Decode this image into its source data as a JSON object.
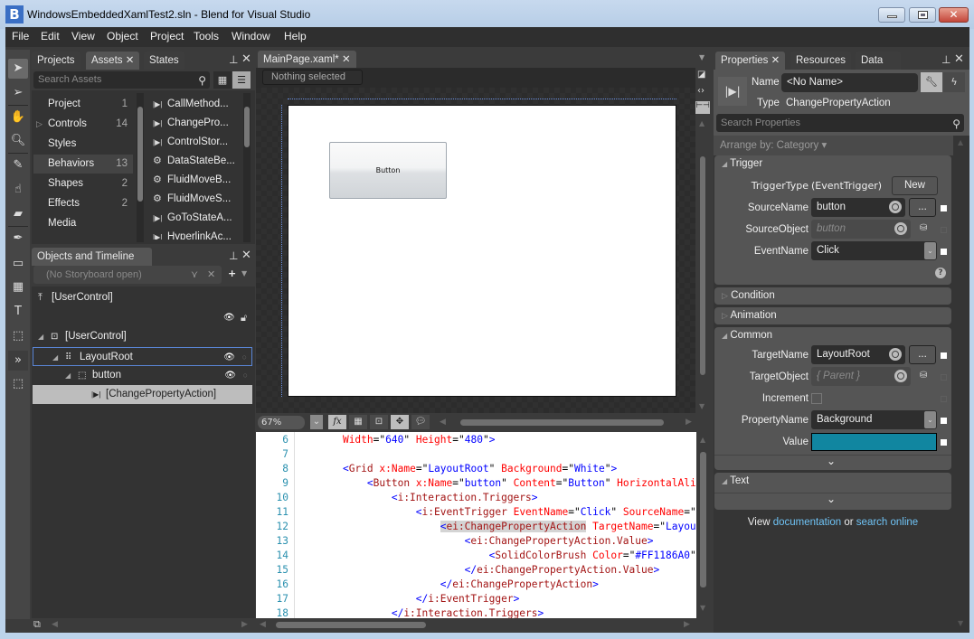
{
  "window": {
    "title": "WindowsEmbeddedXamlTest2.sln - Blend for Visual Studio",
    "logo": "B",
    "close_glyph": "✕"
  },
  "menu": [
    "File",
    "Edit",
    "View",
    "Object",
    "Project",
    "Tools",
    "Window",
    "Help"
  ],
  "tools": [
    "selection-tool",
    "direct-selection-tool",
    "pan-tool",
    "zoom-tool",
    "eyedropper-tool",
    "paint-bucket-tool",
    "gradient-tool",
    "pen-tool",
    "rectangle-tool",
    "grid-tool",
    "textblock-tool",
    "button-tool",
    "assets-tool",
    "recent-asset-tool"
  ],
  "assets_panel": {
    "tabs": [
      "Projects",
      "Assets",
      "States"
    ],
    "active_tab": "Assets",
    "search_placeholder": "Search Assets",
    "categories": [
      {
        "label": "Project",
        "count": "1"
      },
      {
        "label": "Controls",
        "count": "14",
        "expandable": true
      },
      {
        "label": "Styles",
        "count": ""
      },
      {
        "label": "Behaviors",
        "count": "13",
        "selected": true
      },
      {
        "label": "Shapes",
        "count": "2"
      },
      {
        "label": "Effects",
        "count": "2"
      },
      {
        "label": "Media",
        "count": ""
      }
    ],
    "items": [
      {
        "icon": "action-icon",
        "label": "CallMethod..."
      },
      {
        "icon": "action-icon",
        "label": "ChangePro..."
      },
      {
        "icon": "action-icon",
        "label": "ControlStor..."
      },
      {
        "icon": "behavior-icon",
        "label": "DataStateBe..."
      },
      {
        "icon": "behavior-icon",
        "label": "FluidMoveB..."
      },
      {
        "icon": "behavior-icon",
        "label": "FluidMoveS..."
      },
      {
        "icon": "action-icon",
        "label": "GoToStateA..."
      },
      {
        "icon": "action-icon",
        "label": "HyperlinkAc..."
      }
    ]
  },
  "objects_panel": {
    "title": "Objects and Timeline",
    "storyboard": "(No Storyboard open)",
    "scope": "[UserControl]",
    "tree": [
      {
        "label": "[UserControl]",
        "icon": "usercontrol-icon",
        "depth": 0
      },
      {
        "label": "LayoutRoot",
        "icon": "grid-icon",
        "depth": 1,
        "highlighted": true
      },
      {
        "label": "button",
        "icon": "button-icon",
        "depth": 2
      },
      {
        "label": "[ChangePropertyAction]",
        "icon": "action-icon",
        "depth": 3,
        "selected": true
      }
    ]
  },
  "document": {
    "tab": "MainPage.xaml*",
    "selection_status": "Nothing selected",
    "canvas_button_label": "Button",
    "zoom": "67%",
    "view_buttons": [
      "fx",
      "grid",
      "snap-gridlines",
      "snap-points",
      "annotations"
    ]
  },
  "code": {
    "lines": [
      {
        "n": "6",
        "html": "    <span class='a'>Width</span>=\"<span class='v'>640</span>\" <span class='a'>Height</span>=\"<span class='v'>480</span>\"<span class='p'>&gt;</span>"
      },
      {
        "n": "7",
        "html": ""
      },
      {
        "n": "8",
        "html": "    <span class='p'>&lt;</span><span class='t'>Grid</span> <span class='a'>x:Name</span>=\"<span class='v'>LayoutRoot</span>\" <span class='a'>Background</span>=\"<span class='v'>White</span>\"<span class='p'>&gt;</span>"
      },
      {
        "n": "9",
        "html": "        <span class='p'>&lt;</span><span class='t'>Button</span> <span class='a'>x:Name</span>=\"<span class='v'>button</span>\" <span class='a'>Content</span>=\"<span class='v'>Button</span>\" <span class='a'>HorizontalAlignment</span>"
      },
      {
        "n": "10",
        "html": "            <span class='p'>&lt;</span><span class='t'>i:Interaction.Triggers</span><span class='p'>&gt;</span>"
      },
      {
        "n": "11",
        "html": "                <span class='p'>&lt;</span><span class='t'>i:EventTrigger</span> <span class='a'>EventName</span>=\"<span class='v'>Click</span>\" <span class='a'>SourceName</span>=\"<span class='v'>button</span>\""
      },
      {
        "n": "12",
        "html": "                    <span class='hl'><span class='p'>&lt;</span><span class='t'>ei:ChangePropertyAction</span></span> <span class='a'>TargetName</span>=\"<span class='v'>LayoutRoot</span>\""
      },
      {
        "n": "13",
        "html": "                        <span class='p'>&lt;</span><span class='t'>ei:ChangePropertyAction.Value</span><span class='p'>&gt;</span>"
      },
      {
        "n": "14",
        "html": "                            <span class='p'>&lt;</span><span class='t'>SolidColorBrush</span> <span class='a'>Color</span>=\"<span class='v'>#FF1186A0</span>\"<span class='p'>/&gt;</span>"
      },
      {
        "n": "15",
        "html": "                        <span class='p'>&lt;/</span><span class='t'>ei:ChangePropertyAction.Value</span><span class='p'>&gt;</span>"
      },
      {
        "n": "16",
        "html": "                    <span class='p'>&lt;/</span><span class='t'>ei:ChangePropertyAction</span><span class='p'>&gt;</span>"
      },
      {
        "n": "17",
        "html": "                <span class='p'>&lt;/</span><span class='t'>i:EventTrigger</span><span class='p'>&gt;</span>"
      },
      {
        "n": "18",
        "html": "            <span class='p'>&lt;/</span><span class='t'>i:Interaction.Triggers</span><span class='p'>&gt;</span>"
      }
    ]
  },
  "properties": {
    "tabs": [
      "Properties",
      "Resources",
      "Data"
    ],
    "name_label": "Name",
    "name_value": "<No Name>",
    "type_label": "Type",
    "type_value": "ChangePropertyAction",
    "search_placeholder": "Search Properties",
    "arrange_by": "Arrange by: Category ▾",
    "sections": {
      "trigger": {
        "title": "Trigger",
        "trigger_type_label": "TriggerType",
        "trigger_type_value": "(EventTrigger)",
        "new_button": "New",
        "source_name_label": "SourceName",
        "source_name_value": "button",
        "source_object_label": "SourceObject",
        "source_object_value": "button",
        "event_name_label": "EventName",
        "event_name_value": "Click"
      },
      "condition": "Condition",
      "animation": "Animation",
      "common": {
        "title": "Common",
        "target_name_label": "TargetName",
        "target_name_value": "LayoutRoot",
        "target_object_label": "TargetObject",
        "target_object_value": "{ Parent }",
        "increment_label": "Increment",
        "increment_checked": false,
        "property_name_label": "PropertyName",
        "property_name_value": "Background",
        "value_label": "Value",
        "value_color": "#1186A0"
      },
      "text": "Text"
    },
    "footer_prefix": "View ",
    "footer_link1": "documentation",
    "footer_mid": " or ",
    "footer_link2": "search online",
    "ellipsis": "..."
  }
}
